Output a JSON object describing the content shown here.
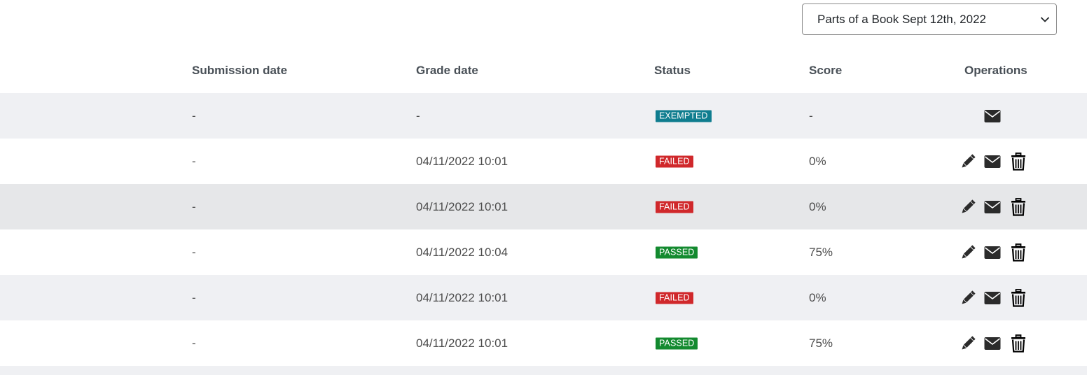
{
  "filter": {
    "selected": "Parts of a Book Sept 12th, 2022"
  },
  "table": {
    "headers": {
      "submission_date": "Submission date",
      "grade_date": "Grade date",
      "status": "Status",
      "score": "Score",
      "operations": "Operations"
    },
    "rows": [
      {
        "submission_date": "-",
        "grade_date": "-",
        "status": "EXEMPTED",
        "score": "-"
      },
      {
        "submission_date": "-",
        "grade_date": "04/11/2022 10:01",
        "status": "FAILED",
        "score": "0%"
      },
      {
        "submission_date": "-",
        "grade_date": "04/11/2022 10:01",
        "status": "FAILED",
        "score": "0%"
      },
      {
        "submission_date": "-",
        "grade_date": "04/11/2022 10:04",
        "status": "PASSED",
        "score": "75%"
      },
      {
        "submission_date": "-",
        "grade_date": "04/11/2022 10:01",
        "status": "FAILED",
        "score": "0%"
      },
      {
        "submission_date": "-",
        "grade_date": "04/11/2022 10:01",
        "status": "PASSED",
        "score": "75%"
      }
    ]
  },
  "status_colors": {
    "EXEMPTED": "#0f7d8f",
    "FAILED": "#d0282b",
    "PASSED": "#138a2f"
  },
  "icons": {
    "edit": "pencil-icon",
    "message": "envelope-icon",
    "delete": "trash-icon",
    "dropdown": "chevron-down-icon"
  }
}
